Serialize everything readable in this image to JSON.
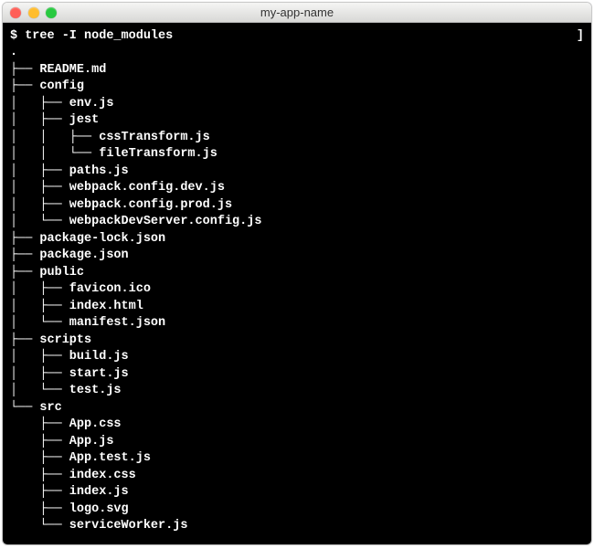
{
  "titlebar": {
    "title": "my-app-name"
  },
  "prompt": "$ ",
  "command": "tree -I node_modules",
  "right_edge": "]",
  "lines": [
    ".",
    "├── README.md",
    "├── config",
    "│   ├── env.js",
    "│   ├── jest",
    "│   │   ├── cssTransform.js",
    "│   │   └── fileTransform.js",
    "│   ├── paths.js",
    "│   ├── webpack.config.dev.js",
    "│   ├── webpack.config.prod.js",
    "│   └── webpackDevServer.config.js",
    "├── package-lock.json",
    "├── package.json",
    "├── public",
    "│   ├── favicon.ico",
    "│   ├── index.html",
    "│   └── manifest.json",
    "├── scripts",
    "│   ├── build.js",
    "│   ├── start.js",
    "│   └── test.js",
    "└── src",
    "    ├── App.css",
    "    ├── App.js",
    "    ├── App.test.js",
    "    ├── index.css",
    "    ├── index.js",
    "    ├── logo.svg",
    "    └── serviceWorker.js"
  ]
}
